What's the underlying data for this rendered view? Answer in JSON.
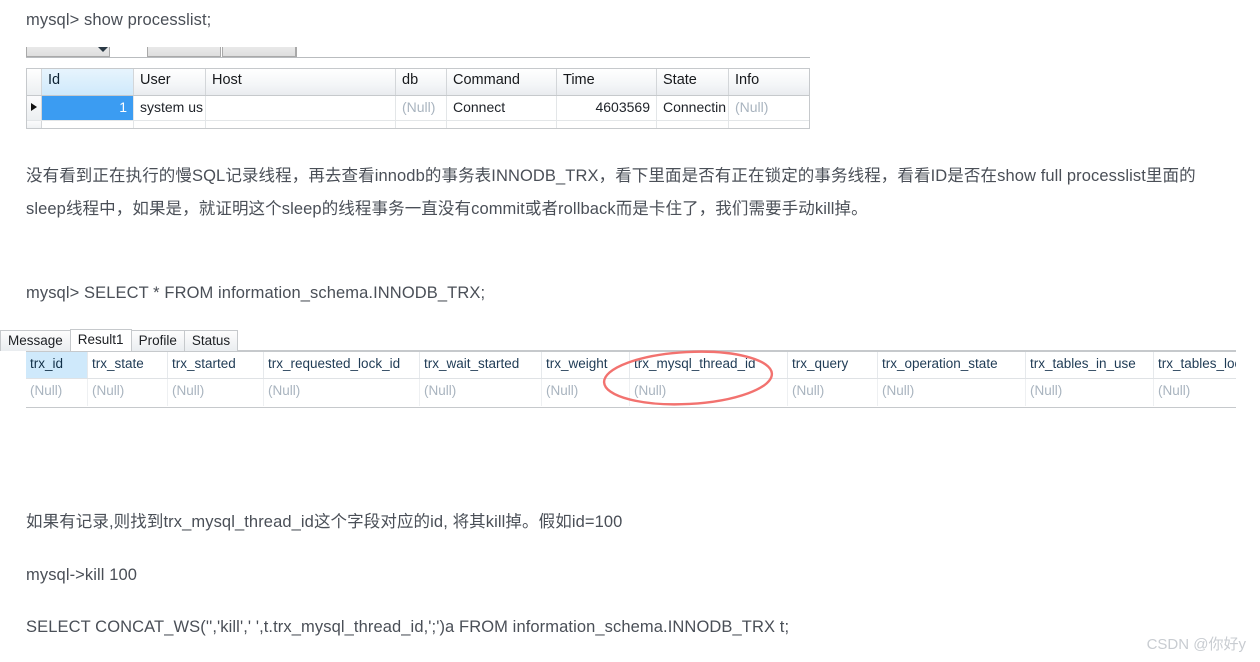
{
  "document": {
    "line1": "mysql> show processlist;",
    "paragraph1": "没有看到正在执行的慢SQL记录线程，再去查看innodb的事务表INNODB_TRX，看下里面是否有正在锁定的事务线程，看看ID是否在show full processlist里面的sleep线程中，如果是，就证明这个sleep的线程事务一直没有commit或者rollback而是卡住了，我们需要手动kill掉。",
    "line2": "mysql> SELECT * FROM information_schema.INNODB_TRX;",
    "line3": "如果有记录,则找到trx_mysql_thread_id这个字段对应的id, 将其kill掉。假如id=100",
    "line4": "mysql->kill  100",
    "line5": "SELECT CONCAT_WS('','kill',' ',t.trx_mysql_thread_id,';')a FROM information_schema.INNODB_TRX t;",
    "watermark": "CSDN @你好y"
  },
  "processlist_table": {
    "columns": [
      "Id",
      "User",
      "Host",
      "db",
      "Command",
      "Time",
      "State",
      "Info"
    ],
    "rows": [
      {
        "Id": "1",
        "User": "system us",
        "Host": "",
        "db": "(Null)",
        "Command": "Connect",
        "Time": "4603569",
        "State": "Connectin",
        "Info": "(Null)"
      }
    ],
    "selected_column": "Id",
    "selected_row_index": 0
  },
  "innodb_trx_panel": {
    "tabs": [
      {
        "label": "Message",
        "active": false
      },
      {
        "label": "Result1",
        "active": true
      },
      {
        "label": "Profile",
        "active": false
      },
      {
        "label": "Status",
        "active": false
      }
    ],
    "columns": [
      "trx_id",
      "trx_state",
      "trx_started",
      "trx_requested_lock_id",
      "trx_wait_started",
      "trx_weight",
      "trx_mysql_thread_id",
      "trx_query",
      "trx_operation_state",
      "trx_tables_in_use",
      "trx_tables_locke"
    ],
    "highlighted_column": "trx_id",
    "annotated_column": "trx_mysql_thread_id",
    "rows": [
      {
        "trx_id": "(Null)",
        "trx_state": "(Null)",
        "trx_started": "(Null)",
        "trx_requested_lock_id": "(Null)",
        "trx_wait_started": "(Null)",
        "trx_weight": "(Null)",
        "trx_mysql_thread_id": "(Null)",
        "trx_query": "(Null)",
        "trx_operation_state": "(Null)",
        "trx_tables_in_use": "(Null)",
        "trx_tables_locke": "(Null)"
      }
    ]
  },
  "annotation": {
    "shape": "red-ellipse",
    "color": "#f2726f",
    "target": "trx_mysql_thread_id"
  },
  "colors": {
    "text": "#4a4f57",
    "selection_blue": "#3b9cf2",
    "header_highlight": "#cfe9fb",
    "null_text": "#a9b4bf",
    "annotation_red": "#f2726f",
    "watermark": "#c8ccd1"
  }
}
